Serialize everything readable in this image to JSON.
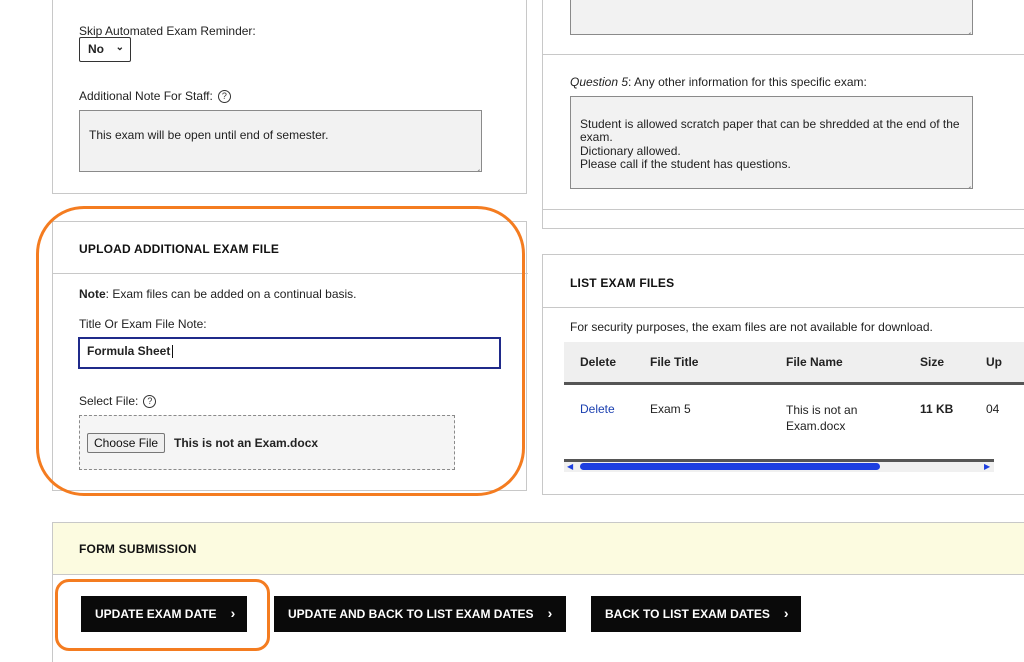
{
  "left_panel": {
    "skip_reminder": {
      "label": "Skip Automated Exam Reminder:",
      "value": "No"
    },
    "staff_note": {
      "label": "Additional Note For Staff:",
      "value": "This exam will be open until end of semester."
    }
  },
  "right_panel": {
    "question5": {
      "prefix": "Question 5",
      "label": ": Any other information for this specific exam:",
      "value": "Student is allowed scratch paper that can be shredded at the end of the exam.\nDictionary allowed.\nPlease call if the student has questions."
    }
  },
  "upload": {
    "title": "UPLOAD ADDITIONAL EXAM FILE",
    "note_bold": "Note",
    "note_text": ": Exam files can be added on a continual basis.",
    "title_field_label": "Title Or Exam File Note:",
    "title_field_value": "Formula Sheet",
    "select_file_label": "Select File:",
    "choose_file_button": "Choose File",
    "chosen_file": "This is not an Exam.docx"
  },
  "files_list": {
    "title": "LIST EXAM FILES",
    "security_note": "For security purposes, the exam files are not available for download.",
    "columns": [
      "Delete",
      "File Title",
      "File Name",
      "Size",
      "Up"
    ],
    "rows": [
      {
        "delete": "Delete",
        "file_title": "Exam 5",
        "file_name": "This is not an Exam.docx",
        "size": "11 KB",
        "uploaded": "04"
      }
    ]
  },
  "form_submission": {
    "title": "FORM SUBMISSION",
    "buttons": {
      "update": "UPDATE EXAM DATE",
      "update_back": "UPDATE AND BACK TO LIST EXAM DATES",
      "back": "BACK TO LIST EXAM DATES"
    },
    "arrow_glyph": "›"
  },
  "colors": {
    "highlight_ring": "#f47c20",
    "submission_header_bg": "#fcfbe0",
    "input_focus_border": "#1f2a8a",
    "link": "#1a3fb0",
    "scroll_thumb": "#1d3fe0"
  },
  "icons": {
    "help": "question-circle-icon",
    "chevron": "chevron-down-icon",
    "arrow": "chevron-right-icon"
  }
}
